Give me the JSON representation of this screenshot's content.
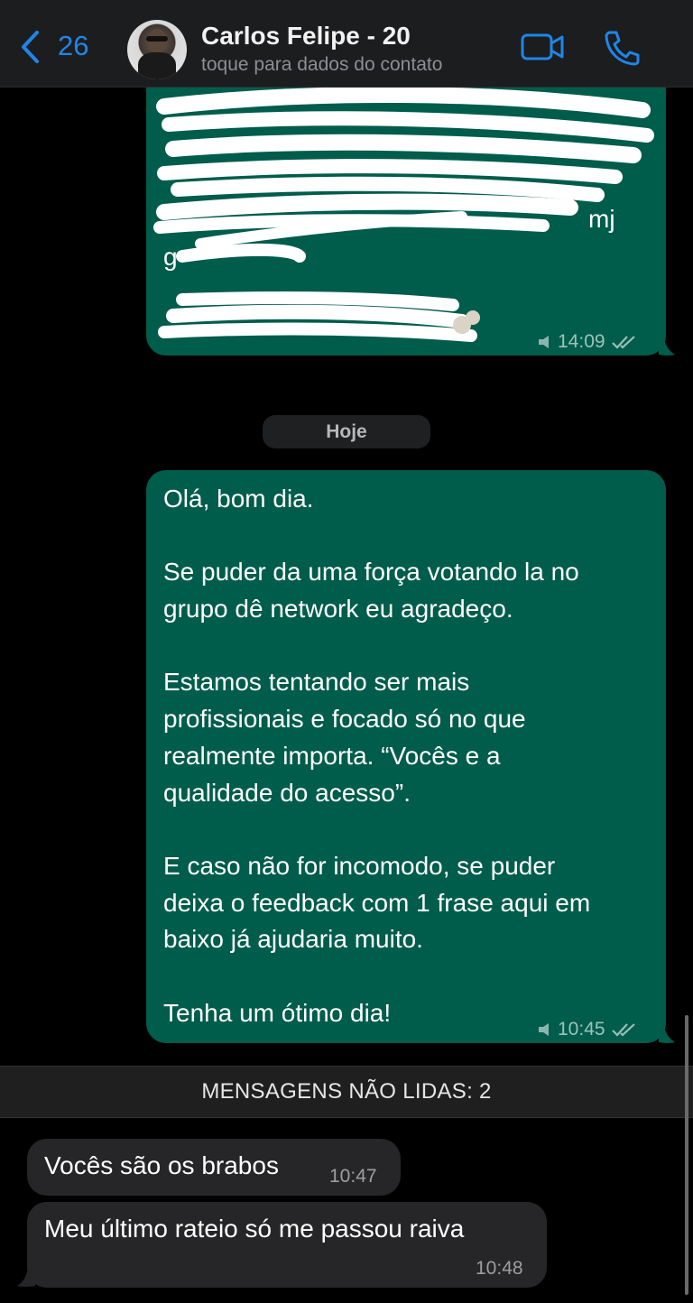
{
  "header": {
    "back_count": "26",
    "contact_name": "Carlos Felipe - 20",
    "contact_subtitle": "toque para dados do contato"
  },
  "colors": {
    "accent": "#1f86e8",
    "outgoing_bubble": "#005c4b",
    "incoming_bubble": "#262628",
    "background": "#000000"
  },
  "messages_old": {
    "line_partial": "mj",
    "line_g": "g",
    "time": "14:09"
  },
  "date_separator": "Hoje",
  "outgoing_message": {
    "lines": [
      "Olá, bom dia.",
      "",
      "Se puder da uma força votando la no",
      "grupo dê network eu agradeço.",
      "",
      "Estamos tentando ser mais",
      "profissionais e focado só no que",
      "realmente importa. “Vocês e a",
      "qualidade do acesso”.",
      "",
      "E caso não for incomodo, se puder",
      "deixa o feedback com 1 frase aqui em",
      "baixo já ajudaria muito.",
      "",
      "Tenha um ótimo dia!"
    ],
    "time": "10:45"
  },
  "unread_banner": "MENSAGENS NÃO LIDAS: 2",
  "incoming_messages": [
    {
      "text": "Vocês são os brabos",
      "time": "10:47"
    },
    {
      "text": "Meu último rateio só me passou raiva",
      "time": "10:48"
    }
  ]
}
